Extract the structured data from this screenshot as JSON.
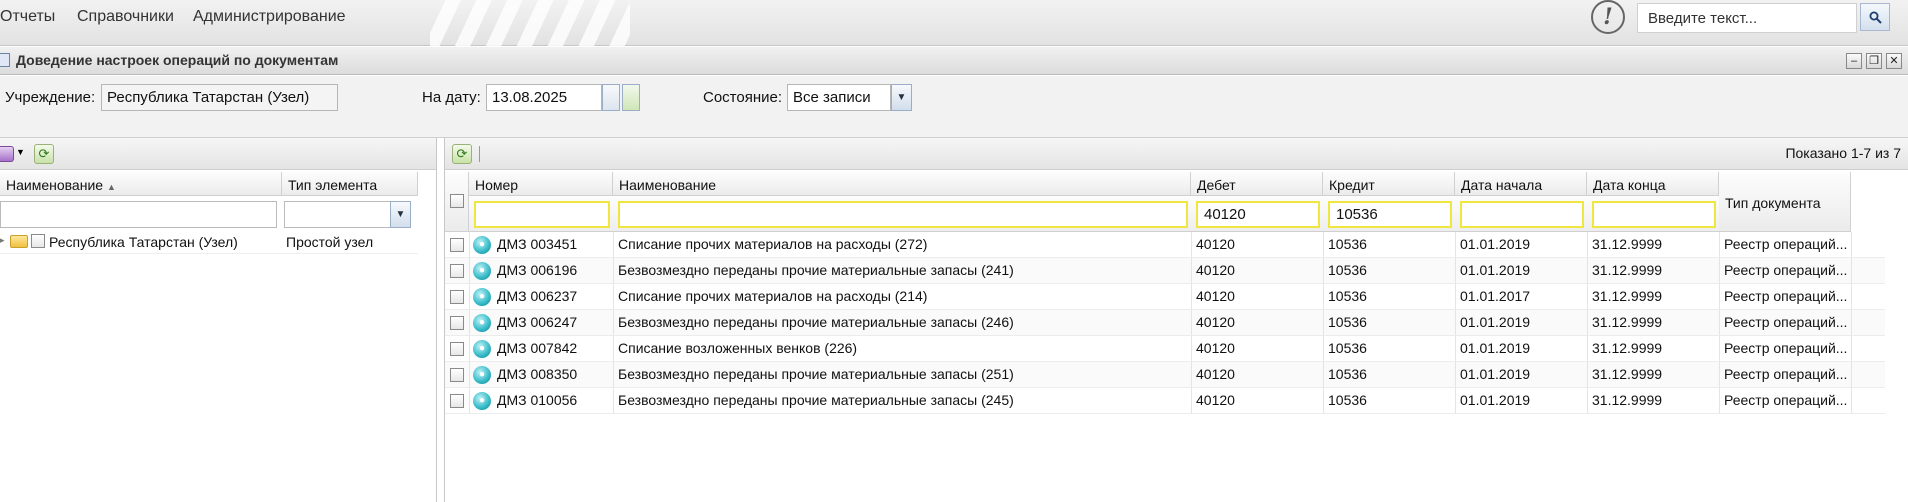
{
  "menu": {
    "items": [
      "Отчеты",
      "Справочники",
      "Администрирование"
    ]
  },
  "global_search": {
    "placeholder": "Введите текст...",
    "button_icon": "search-icon"
  },
  "window": {
    "title": "Доведение настроек операций по документам",
    "controls": [
      "minimize-icon",
      "restore-icon",
      "close-icon"
    ]
  },
  "filters": {
    "institution_label": "Учреждение:",
    "institution_value": "Республика Татарстан (Узел)",
    "date_label": "На дату:",
    "date_value": "13.08.2025",
    "state_label": "Состояние:",
    "state_value": "Все записи"
  },
  "tree": {
    "columns": [
      "Наименование",
      "Тип элемента"
    ],
    "sort_indicator": "▲",
    "nodes": [
      {
        "name": "Республика Татарстан (Узел)",
        "type": "Простой узел"
      }
    ]
  },
  "grid": {
    "paging": "Показано 1-7 из 7",
    "columns": [
      "Номер",
      "Наименование",
      "Дебет",
      "Кредит",
      "Дата начала",
      "Дата конца",
      "Тип документа"
    ],
    "filter_values": {
      "number": "",
      "name": "",
      "debit": "40120",
      "credit": "10536",
      "start": "",
      "end": ""
    },
    "rows": [
      {
        "number": "ДМЗ 003451",
        "name": "Списание прочих материалов на расходы (272)",
        "debit": "40120",
        "credit": "10536",
        "start": "01.01.2019",
        "end": "31.12.9999",
        "doc_type": "Реестр операций..."
      },
      {
        "number": "ДМЗ 006196",
        "name": "Безвозмездно переданы прочие материальные запасы (241)",
        "debit": "40120",
        "credit": "10536",
        "start": "01.01.2019",
        "end": "31.12.9999",
        "doc_type": "Реестр операций..."
      },
      {
        "number": "ДМЗ 006237",
        "name": "Списание прочих материалов на расходы (214)",
        "debit": "40120",
        "credit": "10536",
        "start": "01.01.2017",
        "end": "31.12.9999",
        "doc_type": "Реестр операций..."
      },
      {
        "number": "ДМЗ 006247",
        "name": "Безвозмездно переданы прочие материальные запасы (246)",
        "debit": "40120",
        "credit": "10536",
        "start": "01.01.2019",
        "end": "31.12.9999",
        "doc_type": "Реестр операций..."
      },
      {
        "number": "ДМЗ 007842",
        "name": "Списание возложенных венков (226)",
        "debit": "40120",
        "credit": "10536",
        "start": "01.01.2019",
        "end": "31.12.9999",
        "doc_type": "Реестр операций..."
      },
      {
        "number": "ДМЗ 008350",
        "name": "Безвозмездно переданы прочие материальные запасы (251)",
        "debit": "40120",
        "credit": "10536",
        "start": "01.01.2019",
        "end": "31.12.9999",
        "doc_type": "Реестр операций..."
      },
      {
        "number": "ДМЗ 010056",
        "name": "Безвозмездно переданы прочие материальные запасы (245)",
        "debit": "40120",
        "credit": "10536",
        "start": "01.01.2019",
        "end": "31.12.9999",
        "doc_type": "Реестр операций..."
      }
    ]
  }
}
